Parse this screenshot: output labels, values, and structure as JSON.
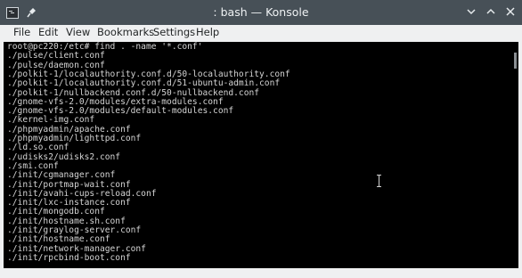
{
  "window": {
    "title": ": bash — Konsole"
  },
  "menu": [
    "File",
    "Edit",
    "View",
    "Bookmarks",
    "Settings",
    "Help"
  ],
  "terminal": {
    "lines": [
      "root@pc220:/etc# find . -name '*.conf'",
      "./pulse/client.conf",
      "./pulse/daemon.conf",
      "./polkit-1/localauthority.conf.d/50-localauthority.conf",
      "./polkit-1/localauthority.conf.d/51-ubuntu-admin.conf",
      "./polkit-1/nullbackend.conf.d/50-nullbackend.conf",
      "./gnome-vfs-2.0/modules/extra-modules.conf",
      "./gnome-vfs-2.0/modules/default-modules.conf",
      "./kernel-img.conf",
      "./phpmyadmin/apache.conf",
      "./phpmyadmin/lighttpd.conf",
      "./ld.so.conf",
      "./udisks2/udisks2.conf",
      "./smi.conf",
      "./init/cgmanager.conf",
      "./init/portmap-wait.conf",
      "./init/avahi-cups-reload.conf",
      "./init/lxc-instance.conf",
      "./init/mongodb.conf",
      "./init/hostname.sh.conf",
      "./init/graylog-server.conf",
      "./init/hostname.conf",
      "./init/network-manager.conf",
      "./init/rpcbind-boot.conf"
    ]
  },
  "colors": {
    "titlebar": "#475057",
    "menubar": "#eff0f1",
    "terminal_bg": "#000000",
    "terminal_fg": "#d4d4d4"
  },
  "icons": [
    "konsole-app-icon",
    "pin-icon",
    "chevron-down-icon",
    "chevron-up-icon",
    "close-icon",
    "ibeam-cursor-icon"
  ]
}
